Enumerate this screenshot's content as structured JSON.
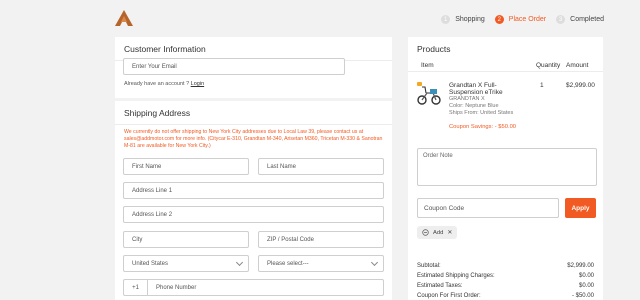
{
  "steps": [
    {
      "num": "1",
      "label": "Shopping"
    },
    {
      "num": "2",
      "label": "Place Order"
    },
    {
      "num": "3",
      "label": "Completed"
    }
  ],
  "customer": {
    "title": "Customer Information",
    "email_placeholder": "Enter Your Email",
    "account_prompt": "Already have an account ?",
    "login_label": "Login"
  },
  "shipping": {
    "title": "Shipping Address",
    "notice": "We currently do not offer shipping to New York City addresses due to Local Law 39, please contact us at sales@addmotor.com for more info. (Citycar E-310, Grandtan M-340, Arisetan M360, Tricetan M-330 & Sanotran M-81 are available for New York City.)",
    "first_name": "First Name",
    "last_name": "Last Name",
    "address1": "Address Line 1",
    "address2": "Address Line 2",
    "city": "City",
    "zip": "ZIP / Postal Code",
    "country": "United States",
    "state": "Please select---",
    "phone_prefix": "+1",
    "phone": "Phone Number"
  },
  "products": {
    "title": "Products",
    "col_item": "Item",
    "col_qty": "Quantity",
    "col_amount": "Amount",
    "item": {
      "name": "Grandtan X Full-Suspension eTrike",
      "subtitle": "GRANDTAN X",
      "color": "Color:  Neptune Blue",
      "ships": "Ships From:  United States",
      "saving": "Coupon Savings:  - $50.00",
      "qty": "1",
      "amount": "$2,999.00"
    },
    "order_note_placeholder": "Order Note",
    "coupon_placeholder": "Coupon Code",
    "apply_label": "Apply",
    "tag_label": "Add",
    "summary": [
      {
        "label": "Subtotal:",
        "value": "$2,999.00"
      },
      {
        "label": "Estimated Shipping Charges:",
        "value": "$0.00"
      },
      {
        "label": "Estimated Taxes:",
        "value": "$0.00"
      },
      {
        "label": "Coupon For First Order:",
        "value": "- $50.00"
      }
    ]
  },
  "colors": {
    "accent": "#f15a22",
    "logo": "#b5652b"
  }
}
